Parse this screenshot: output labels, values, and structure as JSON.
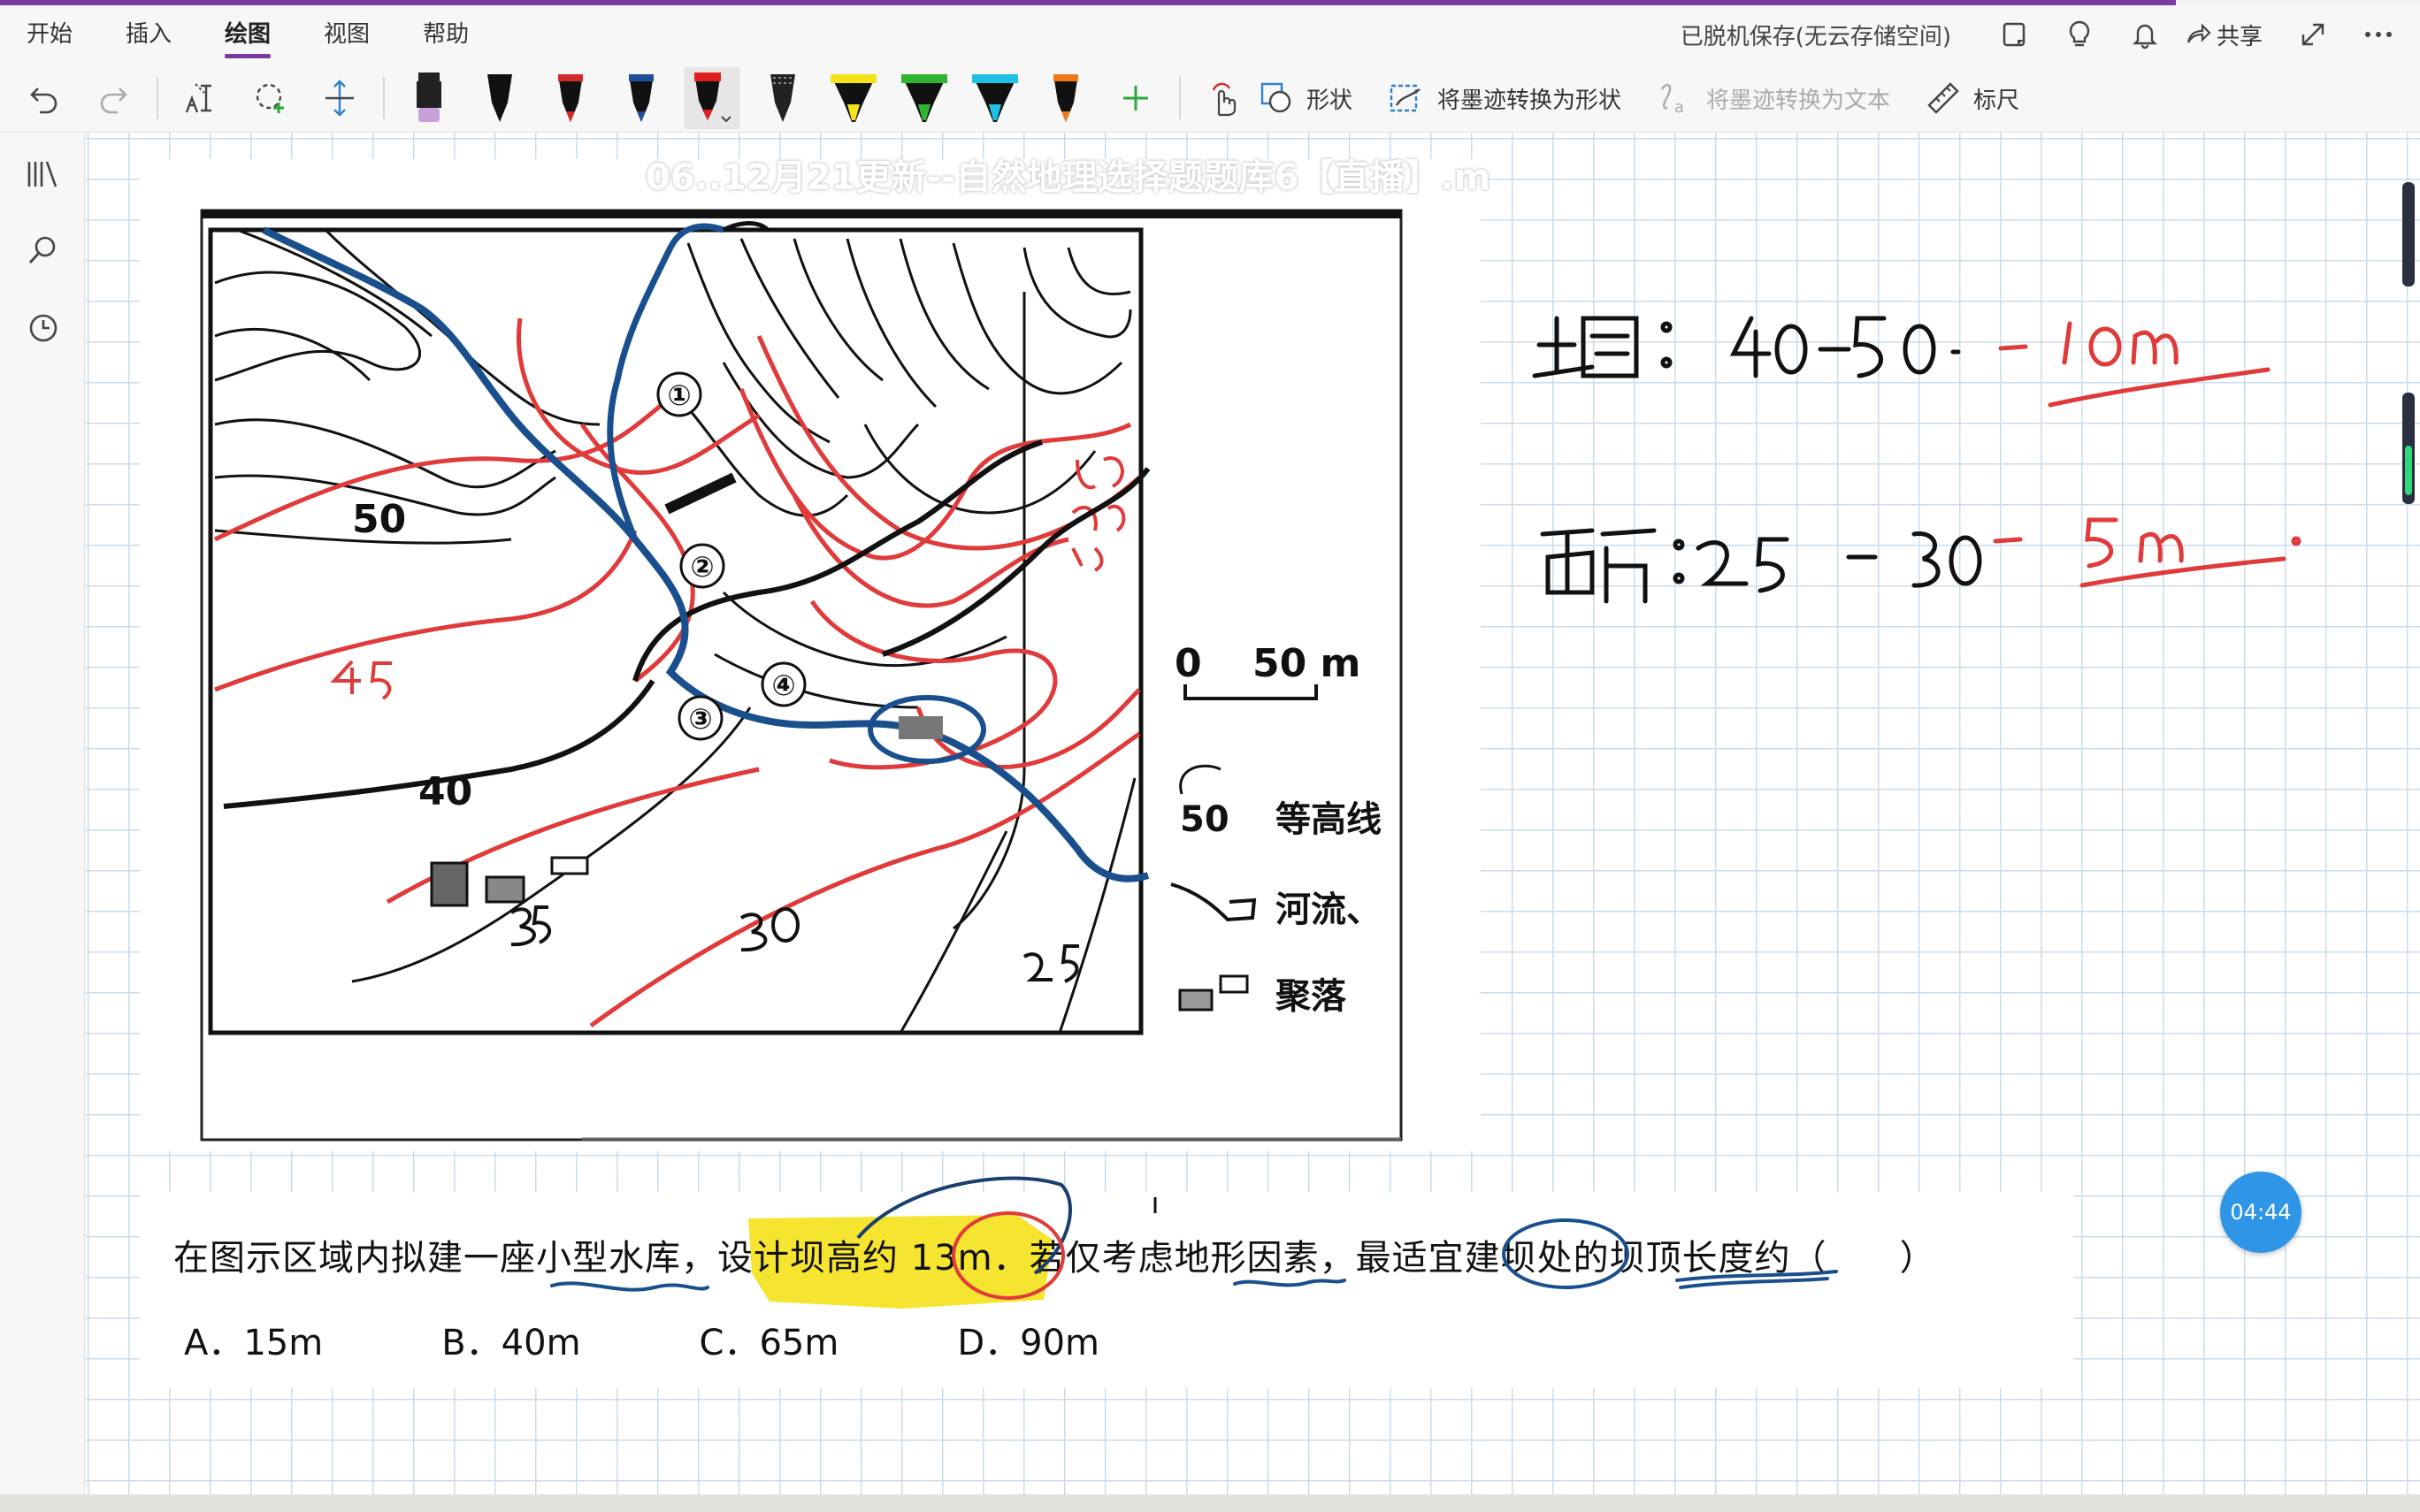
{
  "tabs": [
    {
      "label": "开始"
    },
    {
      "label": "插入"
    },
    {
      "label": "绘图",
      "active": true
    },
    {
      "label": "视图"
    },
    {
      "label": "帮助"
    }
  ],
  "status": {
    "save_text": "已脱机保存(无云存储空间)",
    "share_label": "共享"
  },
  "toolbar": {
    "shape_label": "形状",
    "ink_to_shape_label": "将墨迹转换为形状",
    "ink_to_text_label": "将墨迹转换为文本",
    "ruler_label": "标尺"
  },
  "pens": [
    {
      "name": "pen-purple-highlighter",
      "color": "#c8a0d8"
    },
    {
      "name": "pen-black",
      "color": "#111111"
    },
    {
      "name": "pen-red",
      "color": "#d42a2a"
    },
    {
      "name": "pen-dark-blue",
      "color": "#1f4f9a"
    },
    {
      "name": "pen-red-selected",
      "color": "#e02020"
    },
    {
      "name": "pen-black-pattern",
      "color": "#222222"
    },
    {
      "name": "highlighter-yellow",
      "color": "#f4e21a"
    },
    {
      "name": "highlighter-green",
      "color": "#2fb52f"
    },
    {
      "name": "highlighter-cyan",
      "color": "#1ec0e8"
    },
    {
      "name": "pen-orange",
      "color": "#f07a1a"
    }
  ],
  "map": {
    "title": "06..12月21更新--自然地理选择题题库6【直播】.m",
    "contour_labels": [
      "50",
      "45",
      "40",
      "35",
      "30",
      "25"
    ],
    "legend": {
      "contour_sample": "50",
      "contour_label": "等高线",
      "river_label": "河流、",
      "settlement_label": "聚落",
      "scale_zero": "0",
      "scale_label": "50 m"
    },
    "points": [
      "①",
      "②",
      "③",
      "④"
    ]
  },
  "notes": {
    "upper": "上游：40-50- -10m",
    "lower": "下游：25 -30 - 5 m"
  },
  "question": {
    "text": "在图示区域内拟建一座小型水库，设计坝高约 13m．若仅考虑地形因素，最适宜建坝处的坝顶长度约（　　）",
    "options": [
      "A．15m",
      "B．40m",
      "C．65m",
      "D．90m"
    ]
  },
  "timer": "04:44",
  "colors": {
    "accent": "#7a3aa0",
    "grid": "#c9dcec",
    "ink_red": "#e03a3a",
    "ink_blue": "#1a4f8e"
  }
}
